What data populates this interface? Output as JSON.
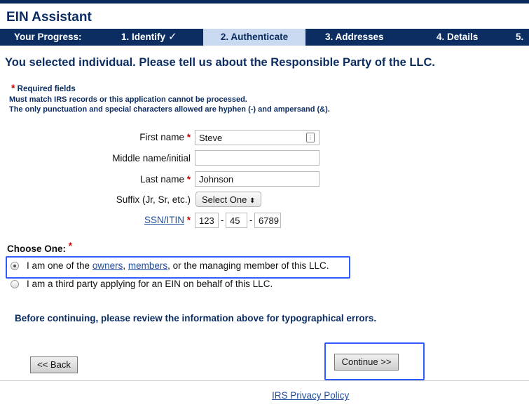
{
  "app": {
    "title": "EIN Assistant"
  },
  "progress": {
    "label": "Your Progress:",
    "steps": [
      {
        "label": "1. Identify",
        "done": true
      },
      {
        "label": "2. Authenticate",
        "active": true
      },
      {
        "label": "3. Addresses"
      },
      {
        "label": "4. Details"
      },
      {
        "label": "5."
      }
    ],
    "check_glyph": "✓"
  },
  "page": {
    "heading": "You selected individual. Please tell us about the Responsible Party of the LLC.",
    "required_star": "*",
    "required_label": "Required fields",
    "note1": "Must match IRS records or this application cannot be processed.",
    "note2": "The only punctuation and special characters allowed are hyphen (-) and ampersand (&)."
  },
  "form": {
    "first_name": {
      "label": "First name",
      "value": "Steve",
      "icon": "keychain-icon"
    },
    "middle_name": {
      "label": "Middle name/initial",
      "value": ""
    },
    "last_name": {
      "label": "Last name",
      "value": "Johnson"
    },
    "suffix": {
      "label": "Suffix (Jr, Sr, etc.)",
      "selected": "Select One",
      "arrow": "⬍"
    },
    "ssn": {
      "label": "SSN/ITIN",
      "part1": "123",
      "part2": "45",
      "part3": "6789",
      "separator": "-"
    }
  },
  "choose": {
    "label": "Choose One:",
    "option1": {
      "prefix": "I am one of the ",
      "link1": "owners",
      "comma": ", ",
      "link2": "members",
      "suffix": ", or the managing member of this LLC.",
      "checked": true
    },
    "option2": {
      "label": "I am a third party applying for an EIN on behalf of this LLC.",
      "checked": false
    }
  },
  "review_text": "Before continuing, please review the information above for typographical errors.",
  "buttons": {
    "back": "<< Back",
    "continue": "Continue >>"
  },
  "footer": {
    "privacy": "IRS Privacy Policy"
  },
  "colors": {
    "navy": "#0c2d62",
    "active_step": "#c9daf0",
    "required": "#cc0000",
    "highlight": "#2e5cff",
    "link": "#1f4e9a"
  }
}
